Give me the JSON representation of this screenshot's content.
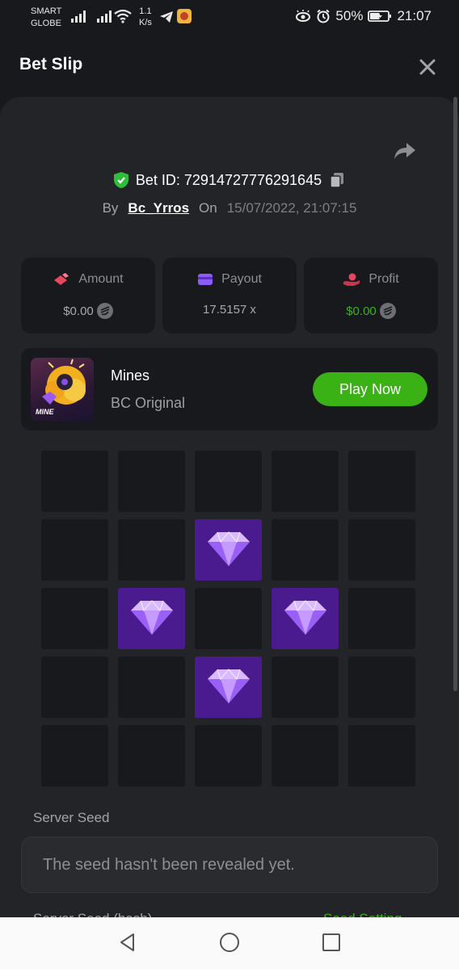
{
  "status_bar": {
    "carrier_line1": "SMART",
    "carrier_line2": "GLOBE",
    "speed_value": "1.1",
    "speed_unit": "K/s",
    "battery": "50%",
    "time": "21:07"
  },
  "header": {
    "title": "Bet Slip",
    "close_icon": "close-icon"
  },
  "bet": {
    "bet_id": "Bet ID: 72914727776291645",
    "by_label": "By",
    "username": "Bc_Yrros",
    "on_label": "On",
    "datetime": "15/07/2022, 21:07:15"
  },
  "stats": {
    "amount": {
      "label": "Amount",
      "value": "$0.00"
    },
    "payout": {
      "label": "Payout",
      "value": "17.5157 x"
    },
    "profit": {
      "label": "Profit",
      "value": "$0.00",
      "color": "#3ab115"
    }
  },
  "game": {
    "name": "Mines",
    "subtitle": "BC Original",
    "thumb_text": "MINE",
    "play_label": "Play Now"
  },
  "board": {
    "rows": 5,
    "cols": 5,
    "cells": [
      0,
      0,
      0,
      0,
      0,
      0,
      0,
      1,
      0,
      0,
      0,
      1,
      0,
      1,
      0,
      0,
      0,
      1,
      0,
      0,
      0,
      0,
      0,
      0,
      0
    ]
  },
  "seed": {
    "server_seed_label": "Server Seed",
    "server_seed_value": "The seed hasn't been revealed yet.",
    "hash_label_partial": "Server Seed (hash)",
    "settings_link_partial": "Seed Setting"
  },
  "colors": {
    "accent_green": "#3ab115",
    "gem_tile": "#4a1b8f",
    "background": "#18191c",
    "card": "#232427"
  }
}
